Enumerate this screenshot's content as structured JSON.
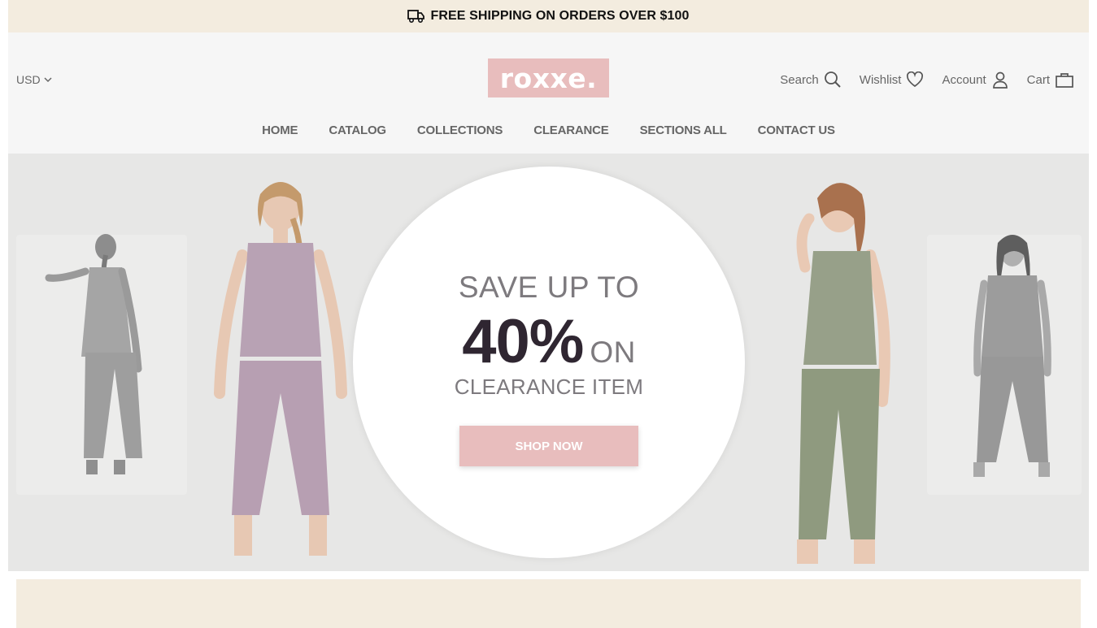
{
  "announcement": {
    "text": "FREE SHIPPING ON ORDERS OVER $100",
    "icon": "truck-icon"
  },
  "header": {
    "currency": "USD",
    "logo_text": "roxxe.",
    "actions": {
      "search": "Search",
      "wishlist": "Wishlist",
      "account": "Account",
      "cart": "Cart"
    }
  },
  "nav": {
    "items": [
      "HOME",
      "CATALOG",
      "COLLECTIONS",
      "CLEARANCE",
      "SECTIONS ALL",
      "CONTACT US"
    ]
  },
  "hero": {
    "line1": "SAVE UP TO",
    "percent": "40%",
    "on": "ON",
    "line3": "CLEARANCE ITEM",
    "button": "SHOP NOW"
  },
  "colors": {
    "accent_pink": "#e8bdbd",
    "cream": "#f3ecdf",
    "dark_text": "#2f2631",
    "lilac": "#b8a2b4",
    "sage": "#8f9a7f",
    "gray_model": "#9a9a9a"
  }
}
